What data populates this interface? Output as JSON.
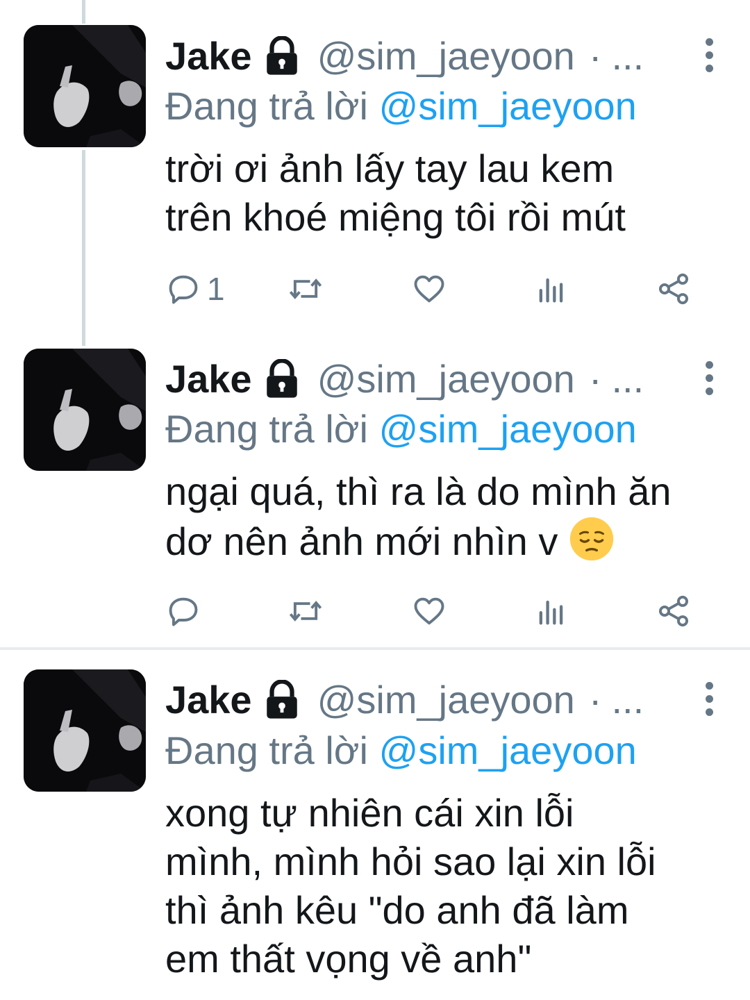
{
  "tweets": [
    {
      "author": {
        "name": "Jake",
        "handle": "@sim_jaeyoon",
        "dot": "·",
        "ellipsis": "..."
      },
      "reply_to": {
        "prefix": "Đang trả lời",
        "mention": "@sim_jaeyoon"
      },
      "text": "trời ơi ảnh lấy tay lau kem\ntrên khoé miệng tôi rồi mút",
      "reply_count": "1",
      "icons": [
        "lock-icon",
        "more-icon",
        "reply-icon",
        "retweet-icon",
        "like-icon",
        "analytics-icon",
        "share-icon"
      ]
    },
    {
      "author": {
        "name": "Jake",
        "handle": "@sim_jaeyoon",
        "dot": "·",
        "ellipsis": "..."
      },
      "reply_to": {
        "prefix": "Đang trả lời",
        "mention": "@sim_jaeyoon"
      },
      "text_line1": "ngại quá, thì ra là do mình ăn",
      "text_line2": "dơ nên ảnh mới nhìn v",
      "emoji": "pensive-face-emoji",
      "reply_count": ""
    },
    {
      "author": {
        "name": "Jake",
        "handle": "@sim_jaeyoon",
        "dot": "·",
        "ellipsis": "..."
      },
      "reply_to": {
        "prefix": "Đang trả lời",
        "mention": "@sim_jaeyoon"
      },
      "text": "xong tự nhiên cái xin lỗi\nmình, mình hỏi sao lại xin lỗi\nthì ảnh kêu \"do anh đã làm\nem thất vọng về anh\""
    }
  ],
  "colors": {
    "text": "#14171a",
    "secondary": "#657786",
    "link": "#1da1f2",
    "thread_line": "#cfd9de",
    "divider": "#e6ecf0",
    "emoji_yellow": "#ffcc4d"
  }
}
